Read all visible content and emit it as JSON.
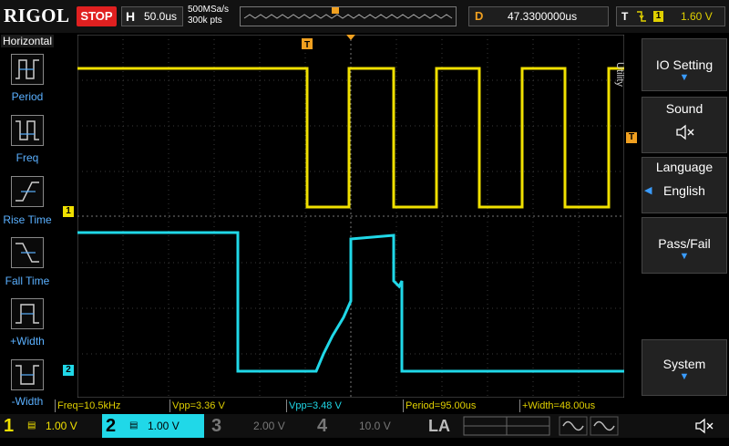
{
  "topbar": {
    "logo": "RIGOL",
    "run_state": "STOP",
    "timebase_key": "H",
    "timebase": "50.0us",
    "sample_rate": "500MSa/s",
    "memory_depth": "300k pts",
    "delay_key": "D",
    "delay": "47.3300000us",
    "trigger_key": "T",
    "trigger_channel": "1",
    "trigger_level": "1.60 V"
  },
  "left_menu": {
    "title": "Horizontal",
    "items": [
      {
        "label": "Period"
      },
      {
        "label": "Freq"
      },
      {
        "label": "Rise Time"
      },
      {
        "label": "Fall Time"
      },
      {
        "label": "+Width"
      },
      {
        "label": "-Width"
      }
    ]
  },
  "right_menu": {
    "side_label": "Utility",
    "items": [
      {
        "label": "IO Setting"
      },
      {
        "label": "Sound"
      },
      {
        "label": "Language",
        "value": "English"
      },
      {
        "label": "Pass/Fail"
      },
      {
        "label": "System"
      }
    ]
  },
  "markers": {
    "ch1": "1",
    "ch2": "2",
    "trigger": "T"
  },
  "measurements": [
    {
      "text": "Freq=10.5kHz"
    },
    {
      "text": "Vpp=3.36 V"
    },
    {
      "text": "Vpp=3.48 V"
    },
    {
      "text": "Period=95.00us"
    },
    {
      "text": "+Width=48.00us"
    }
  ],
  "channels": [
    {
      "num": "1",
      "scale": "1.00 V"
    },
    {
      "num": "2",
      "scale": "1.00 V"
    },
    {
      "num": "3",
      "scale": "2.00 V"
    },
    {
      "num": "4",
      "scale": "10.0 V"
    }
  ],
  "la_label": "LA",
  "colors": {
    "ch1": "#f0e000",
    "ch2": "#20d8e8",
    "ch3": "#cc44cc",
    "ch4": "#3366ff",
    "trigger": "#f0a020",
    "accent": "#3a9cff"
  }
}
